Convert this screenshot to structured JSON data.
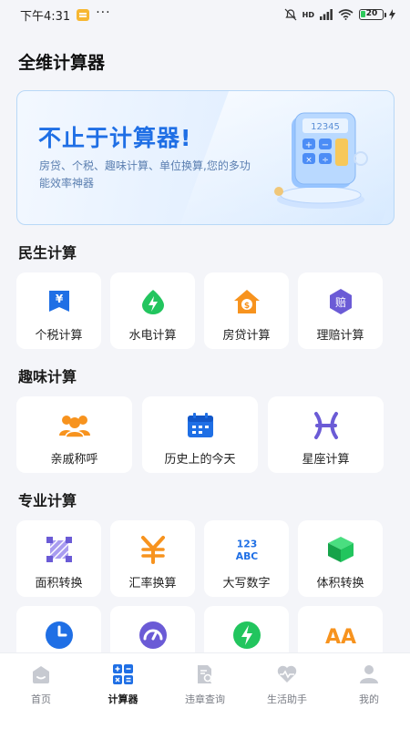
{
  "status_bar": {
    "time": "下午4:31",
    "dots": "···",
    "network": "HD",
    "battery": "20"
  },
  "page": {
    "title": "全维计算器"
  },
  "banner": {
    "title": "不止于计算器!",
    "subtitle": "房贷、个税、趣味计算、单位换算,您的多功能效率神器",
    "display_value": "12345"
  },
  "sections": [
    {
      "title": "民生计算",
      "items": [
        {
          "label": "个税计算",
          "icon": "yen-bookmark-icon"
        },
        {
          "label": "水电计算",
          "icon": "water-drop-lightning-icon"
        },
        {
          "label": "房贷计算",
          "icon": "house-dollar-icon"
        },
        {
          "label": "理赔计算",
          "icon": "claim-badge-icon",
          "icon_text": "赔"
        }
      ]
    },
    {
      "title": "趣味计算",
      "items": [
        {
          "label": "亲戚称呼",
          "icon": "family-icon"
        },
        {
          "label": "历史上的今天",
          "icon": "calendar-icon"
        },
        {
          "label": "星座计算",
          "icon": "pisces-icon"
        }
      ]
    },
    {
      "title": "专业计算",
      "items": [
        {
          "label": "面积转换",
          "icon": "area-icon"
        },
        {
          "label": "汇率换算",
          "icon": "yen-icon"
        },
        {
          "label": "大写数字",
          "icon": "123-abc-icon",
          "icon_text_top": "123",
          "icon_text_bottom": "ABC"
        },
        {
          "label": "体积转换",
          "icon": "cube-icon"
        },
        {
          "label": "",
          "icon": "clock-icon"
        },
        {
          "label": "",
          "icon": "speedometer-icon"
        },
        {
          "label": "",
          "icon": "lightning-icon"
        },
        {
          "label": "",
          "icon": "font-size-icon",
          "icon_text": "AA"
        }
      ]
    }
  ],
  "tab_bar": {
    "tabs": [
      {
        "label": "首页",
        "icon": "home-icon",
        "active": false
      },
      {
        "label": "计算器",
        "icon": "calculator-icon",
        "active": true
      },
      {
        "label": "违章查询",
        "icon": "document-search-icon",
        "active": false
      },
      {
        "label": "生活助手",
        "icon": "heart-pulse-icon",
        "active": false
      },
      {
        "label": "我的",
        "icon": "user-icon",
        "active": false
      }
    ]
  },
  "colors": {
    "primary": "#1f6fe5",
    "orange": "#f7931e",
    "green": "#22c55e",
    "purple": "#6b5bd6"
  }
}
